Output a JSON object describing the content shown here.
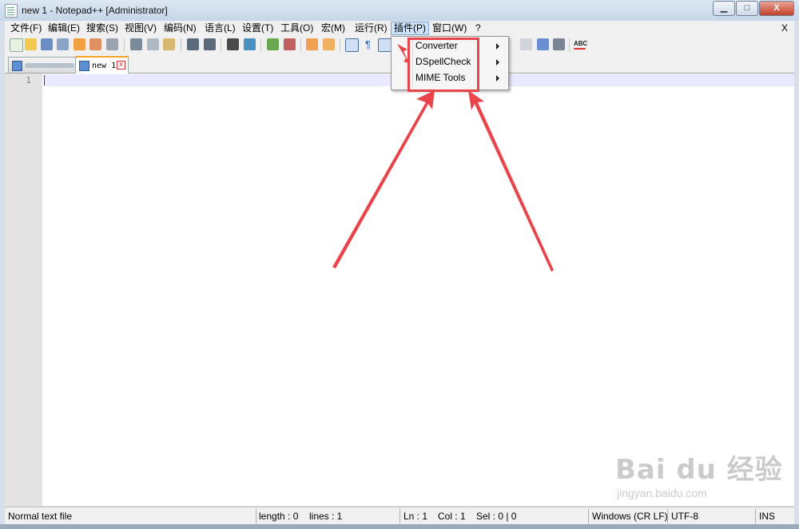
{
  "window": {
    "title": "new 1 - Notepad++ [Administrator]",
    "minimize": "▁",
    "maximize": "□",
    "close": "X"
  },
  "menubar": {
    "items": [
      "文件(F)",
      "编辑(E)",
      "搜索(S)",
      "视图(V)",
      "编码(N)",
      "语言(L)",
      "设置(T)",
      "工具(O)",
      "宏(M)",
      "运行(R)",
      "插件(P)",
      "窗口(W)",
      "?"
    ],
    "active": "插件(P)",
    "close_doc": "X"
  },
  "tabs": [
    {
      "label": "",
      "active": false
    },
    {
      "label": "new 1",
      "active": true,
      "close": "x"
    }
  ],
  "editor": {
    "line_numbers": [
      "1"
    ]
  },
  "plugins_menu": {
    "items": [
      {
        "label": "Converter"
      },
      {
        "label": "DSpellCheck"
      },
      {
        "label": "MIME Tools"
      }
    ]
  },
  "statusbar": {
    "file_type": "Normal text file",
    "length": "length : 0",
    "lines": "lines : 1",
    "ln": "Ln : 1",
    "col": "Col : 1",
    "sel": "Sel : 0 | 0",
    "eol": "Windows (CR LF)",
    "encoding": "UTF-8",
    "mode": "INS"
  },
  "watermark": {
    "main": "Bai du 经验",
    "sub": "jingyan.baidu.com"
  },
  "colors": {
    "annotation": "#e8444a",
    "menu_highlight": "#cde4fa",
    "caret": "#8000ff"
  }
}
